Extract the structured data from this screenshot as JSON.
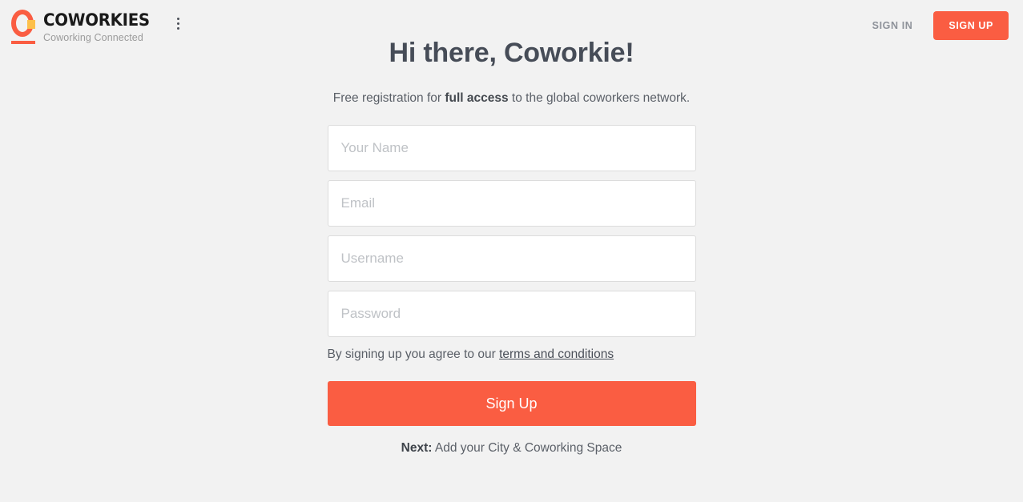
{
  "brand": {
    "name": "COWORKIES",
    "tagline": "Coworking Connected",
    "logo_icon": "coworkies-o-logo",
    "menu_icon": "kebab-menu-icon",
    "accent_color": "#fa5d42",
    "accent_secondary_color": "#fdc04b"
  },
  "header": {
    "sign_in_label": "SIGN IN",
    "sign_up_label": "SIGN UP"
  },
  "main": {
    "title": "Hi there, Coworkie!",
    "subtitle_before": "Free registration for ",
    "subtitle_bold": "full access",
    "subtitle_after": " to the global coworkers network."
  },
  "form": {
    "fields": [
      {
        "name": "name",
        "placeholder": "Your Name",
        "value": "",
        "type": "text"
      },
      {
        "name": "email",
        "placeholder": "Email",
        "value": "",
        "type": "text"
      },
      {
        "name": "username",
        "placeholder": "Username",
        "value": "",
        "type": "text"
      },
      {
        "name": "password",
        "placeholder": "Password",
        "value": "",
        "type": "password"
      }
    ],
    "terms_text": "By signing up you agree to our ",
    "terms_link_label": "terms and conditions",
    "submit_label": "Sign Up",
    "next_label": "Next:",
    "next_text": " Add your City & Coworking Space"
  },
  "colors": {
    "page_background": "#f2f2f2",
    "primary": "#fa5d42",
    "text": "#4a4f58",
    "placeholder": "#bfc2c6",
    "border": "#dcdcdc"
  }
}
